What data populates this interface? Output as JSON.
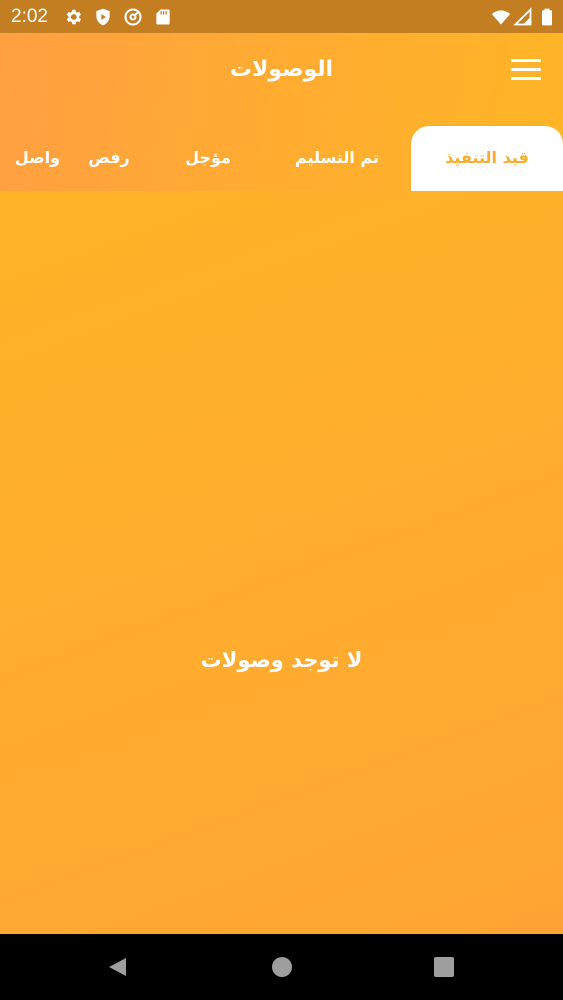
{
  "status_bar": {
    "time": "2:02",
    "icons": [
      "settings-icon",
      "shield-play-icon",
      "at-sign-icon",
      "sd-card-icon",
      "wifi-icon",
      "signal-icon",
      "battery-icon"
    ]
  },
  "app_bar": {
    "title": "الوصولات",
    "menu_icon": "hamburger-menu-icon"
  },
  "tabs": [
    {
      "label": "قيد التنفيذ",
      "active": true
    },
    {
      "label": "تم التسليم",
      "active": false
    },
    {
      "label": "مؤجل",
      "active": false
    },
    {
      "label": "رفض",
      "active": false
    },
    {
      "label": "واصل",
      "active": false
    }
  ],
  "content": {
    "empty_message": "لا توجد وصولات"
  },
  "nav_bar": {
    "icons": [
      "back-icon",
      "home-icon",
      "recents-icon"
    ]
  },
  "colors": {
    "status_bar": "#c37e22",
    "accent_orange": "#ffac2f",
    "active_tab_text": "#f6ad2f",
    "text_white": "#ffffff",
    "nav_bar": "#000000"
  }
}
